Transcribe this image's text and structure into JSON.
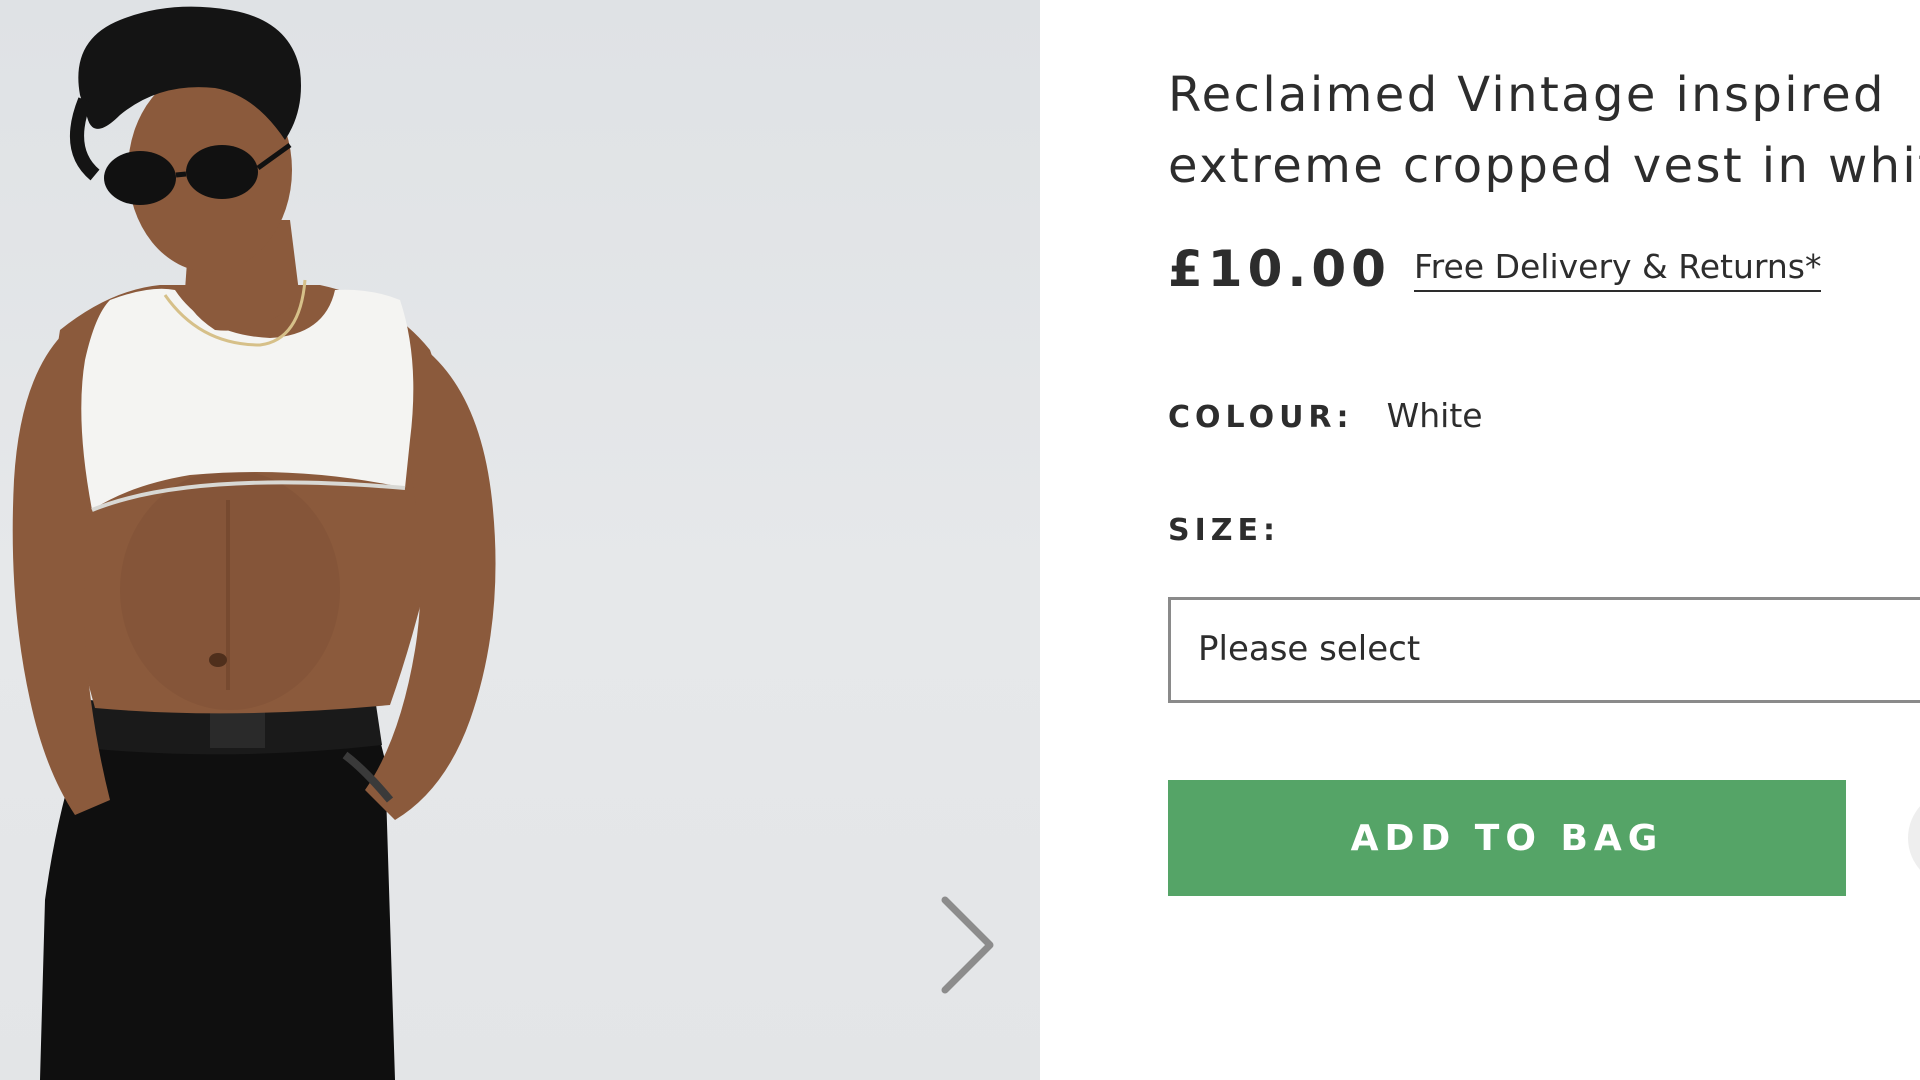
{
  "product": {
    "title_line_1": "Reclaimed Vintage inspired",
    "title_line_2": "extreme cropped vest in white",
    "price": "£10.00",
    "delivery_link": "Free Delivery & Returns*"
  },
  "colour": {
    "label": "COLOUR:",
    "value": "White"
  },
  "size": {
    "label": "SIZE:",
    "selected": "Please select"
  },
  "actions": {
    "add_to_bag_label": "ADD TO BAG"
  },
  "colors": {
    "add_to_bag_bg": "#55a467",
    "text": "#2d2d2d",
    "image_bg": "#e3e5e7"
  },
  "icons": {
    "gallery_next": "chevron-right-icon",
    "save": "heart-icon"
  }
}
